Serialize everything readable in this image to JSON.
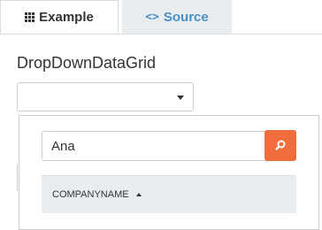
{
  "tabs": [
    {
      "label": "Example",
      "icon": "grid-icon",
      "active": true
    },
    {
      "label": "Source",
      "icon": "code-icon",
      "active": false
    }
  ],
  "source_icon_glyph": "<>",
  "page_title": "DropDownDataGrid",
  "dropdown": {
    "value": "",
    "icon": "caret-down-icon"
  },
  "search": {
    "value": "Ana",
    "button_icon": "search-icon",
    "button_color": "#f26d3d"
  },
  "grid": {
    "columns": [
      {
        "label": "COMPANYNAME",
        "sort": "ascending"
      }
    ]
  }
}
